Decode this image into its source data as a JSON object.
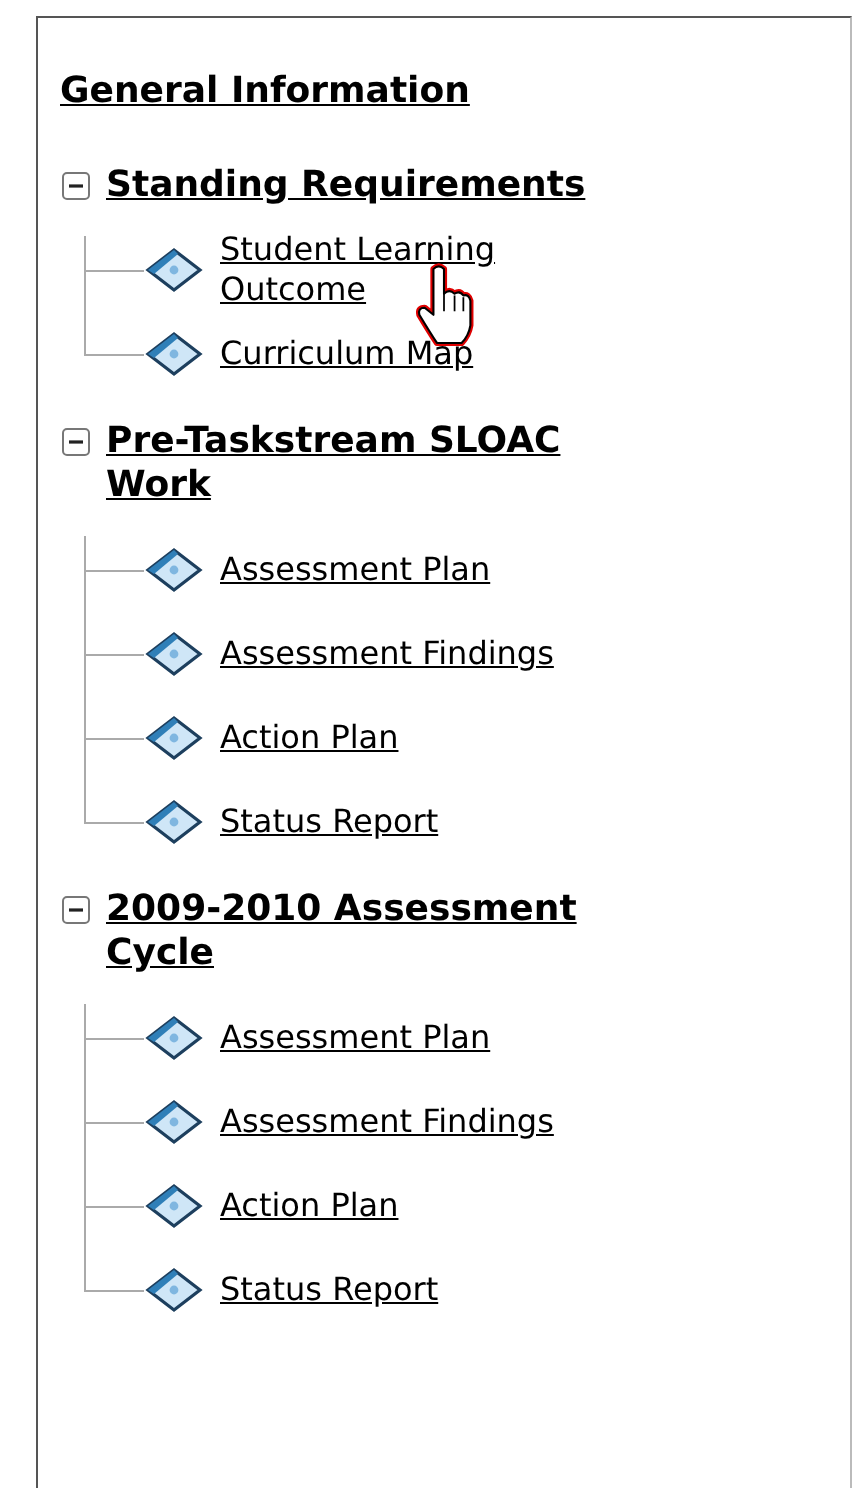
{
  "title": "General Information",
  "sections": [
    {
      "title": "Standing Requirements",
      "expanded": true,
      "children": [
        {
          "label": "Student Learning Outcome",
          "hovered": true
        },
        {
          "label": "Curriculum Map",
          "hovered": false
        }
      ]
    },
    {
      "title": "Pre-Taskstream SLOAC Work",
      "expanded": true,
      "children": [
        {
          "label": "Assessment Plan",
          "hovered": false
        },
        {
          "label": "Assessment Findings",
          "hovered": false
        },
        {
          "label": "Action Plan",
          "hovered": false
        },
        {
          "label": "Status Report",
          "hovered": false
        }
      ]
    },
    {
      "title": "2009-2010 Assessment Cycle",
      "expanded": true,
      "children": [
        {
          "label": "Assessment Plan",
          "hovered": false
        },
        {
          "label": "Assessment Findings",
          "hovered": false
        },
        {
          "label": "Action Plan",
          "hovered": false
        },
        {
          "label": "Status Report",
          "hovered": false
        }
      ]
    }
  ]
}
